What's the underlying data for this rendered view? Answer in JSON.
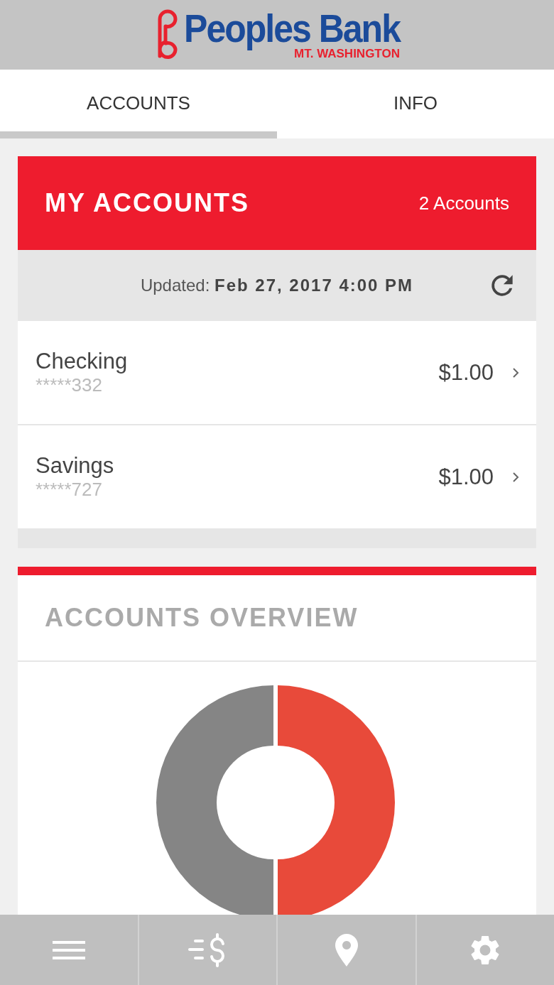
{
  "header": {
    "brand": "Peoples Bank",
    "branch": "MT. WASHINGTON"
  },
  "tabs": [
    {
      "label": "ACCOUNTS",
      "selected": true
    },
    {
      "label": "INFO",
      "selected": false
    }
  ],
  "accounts_card": {
    "title": "MY ACCOUNTS",
    "count": "2 Accounts",
    "updated": "Updated: **Feb 27, 2017 4:00 PM**",
    "accounts": [
      {
        "name": "Checking",
        "number": "*****332",
        "balance": "$1.00"
      },
      {
        "name": "Savings",
        "number": "*****727",
        "balance": "$1.00"
      }
    ]
  },
  "overview": {
    "title": "ACCOUNTS OVERVIEW"
  },
  "bottom_nav": [
    {
      "kind": "menu"
    },
    {
      "kind": "transfer"
    },
    {
      "kind": "location"
    },
    {
      "kind": "settings"
    }
  ]
}
